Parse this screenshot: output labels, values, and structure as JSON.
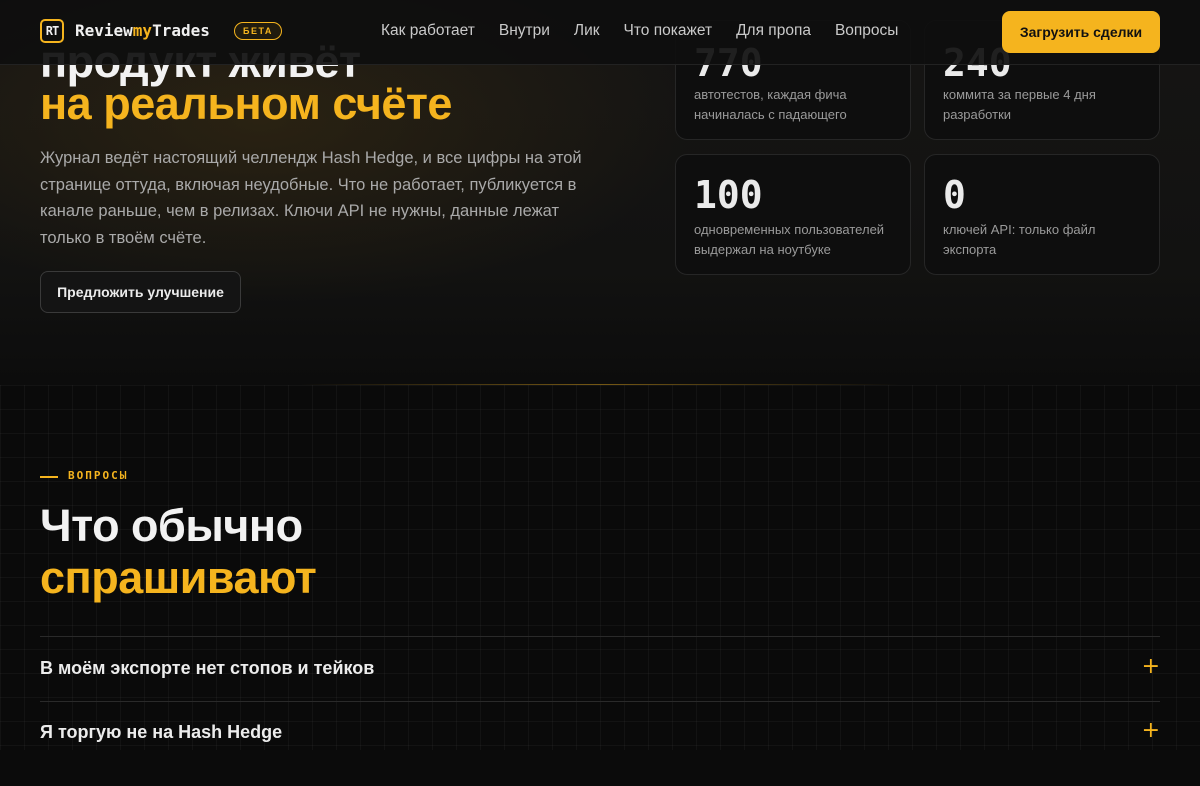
{
  "header": {
    "logo_text": "RT",
    "brand_start": "Review",
    "brand_mid": "my",
    "brand_end": "Trades",
    "beta_badge": "БЕТА",
    "nav": [
      "Как работает",
      "Внутри",
      "Лик",
      "Что покажет",
      "Для пропа",
      "Вопросы"
    ],
    "cta_label": "Загрузить сделки"
  },
  "hero": {
    "title_line1": "продукт живёт",
    "title_line2": "на реальном счёте",
    "description": "Журнал ведёт настоящий челлендж Hash Hedge, и все цифры на этой странице оттуда, включая неудобные. Что не работает, публикуется в канале раньше, чем в релизах. Ключи API не нужны, данные лежат только в твоём счёте.",
    "suggest_button": "Предложить улучшение"
  },
  "stats": [
    {
      "value": "770",
      "label": "автотестов, каждая фича начиналась с падающего"
    },
    {
      "value": "240",
      "label": "коммита за первые 4 дня разработки"
    },
    {
      "value": "100",
      "label": "одновременных пользователей выдержал на ноутбуке"
    },
    {
      "value": "0",
      "label": "ключей API: только файл экспорта"
    }
  ],
  "faq": {
    "eyebrow": "ВОПРОСЫ",
    "title_line1": "Что обычно",
    "title_line2": "спрашивают",
    "items": [
      {
        "question": "В моём экспорте нет стопов и тейков",
        "icon": "plus-icon"
      },
      {
        "question": "Я торгую не на Hash Hedge",
        "icon": "plus-icon"
      }
    ]
  },
  "colors": {
    "accent": "#f5b41e",
    "background": "#0b0b0b"
  }
}
